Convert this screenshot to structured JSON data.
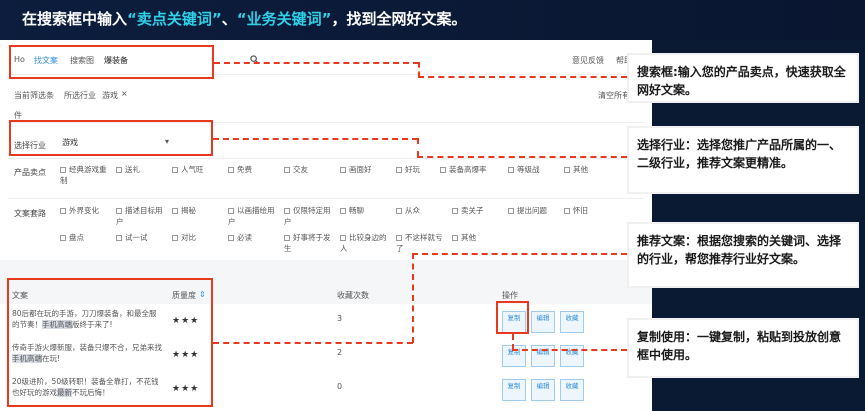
{
  "banner": {
    "prefix": "在搜索框中输入",
    "kw1": "“卖点关键词”",
    "sep": "、",
    "kw2": "“业务关键词”",
    "suffix": "，找到全网好文案。"
  },
  "topbar": {
    "logo": "Ho",
    "tabs": [
      "找文案",
      "搜索图"
    ],
    "search_value": "爆装备",
    "right_links": [
      "意见反馈",
      "帮助"
    ]
  },
  "filters": {
    "current_label": "当前筛选条",
    "industry_label": "所选行业",
    "industry_value": "游戏",
    "close_x": "×",
    "clear_all": "清空所有条",
    "piece_label": "件"
  },
  "industry": {
    "label": "选择行业",
    "selected": "游戏",
    "arrow": "▾"
  },
  "selling_points": {
    "label": "产品卖点",
    "options": [
      "经典游戏重制",
      "送礼",
      "人气旺",
      "免费",
      "交友",
      "画面好",
      "好玩",
      "装备高爆率",
      "等级战",
      "其他"
    ]
  },
  "copy_styles": {
    "label": "文案套路",
    "options_row1": [
      "外界变化",
      "描述目标用户",
      "揭秘",
      "以画描绘用户",
      "仅限特定用户",
      "畅聊",
      "从众",
      "卖关子",
      "提出问题",
      "怀旧"
    ],
    "options_row2": [
      "盘点",
      "试一试",
      "对比",
      "必读",
      "好事将于发生",
      "比较身边的人",
      "不这样就亏了",
      "其他"
    ]
  },
  "table": {
    "col_copy": "文案",
    "col_quality": "质量度",
    "col_count": "收藏次数",
    "col_ops": "操作",
    "rows": [
      {
        "text_a": "80后都在玩的手游，刀刀爆装备，和最全服的节奏！",
        "text_mark": "手机高端",
        "text_b": "版终于来了!",
        "quality": "★★★",
        "count": "3"
      },
      {
        "text_a": "传奇手游火爆新服，装备只爆不合，兄弟来找",
        "text_mark": "手机高端",
        "text_b": "在玩!",
        "quality": "★★★",
        "count": "2"
      },
      {
        "text_a": "20级进阶，50级转职！装备全靠打，不花钱也好玩的游戏",
        "text_mark": "最新",
        "text_b": "不玩后悔！",
        "quality": "★★★",
        "count": "0"
      }
    ],
    "btn_copy": "复制",
    "btn_edit": "编辑",
    "btn_fav": "收藏"
  },
  "callouts": [
    "搜索框:输入您的产品卖点，快速获取全网好文案。",
    "选择行业：选择您推广产品所属的一、二级行业，推荐文案更精准。",
    "推荐文案：根据您搜索的关键词、选择的行业，帮您推荐行业好文案。",
    "复制使用：一键复制，粘贴到投放创意框中使用。"
  ],
  "colors": {
    "highlight": "#2fd0e8",
    "marker": "#e8391e",
    "link": "#2f8fd6"
  }
}
